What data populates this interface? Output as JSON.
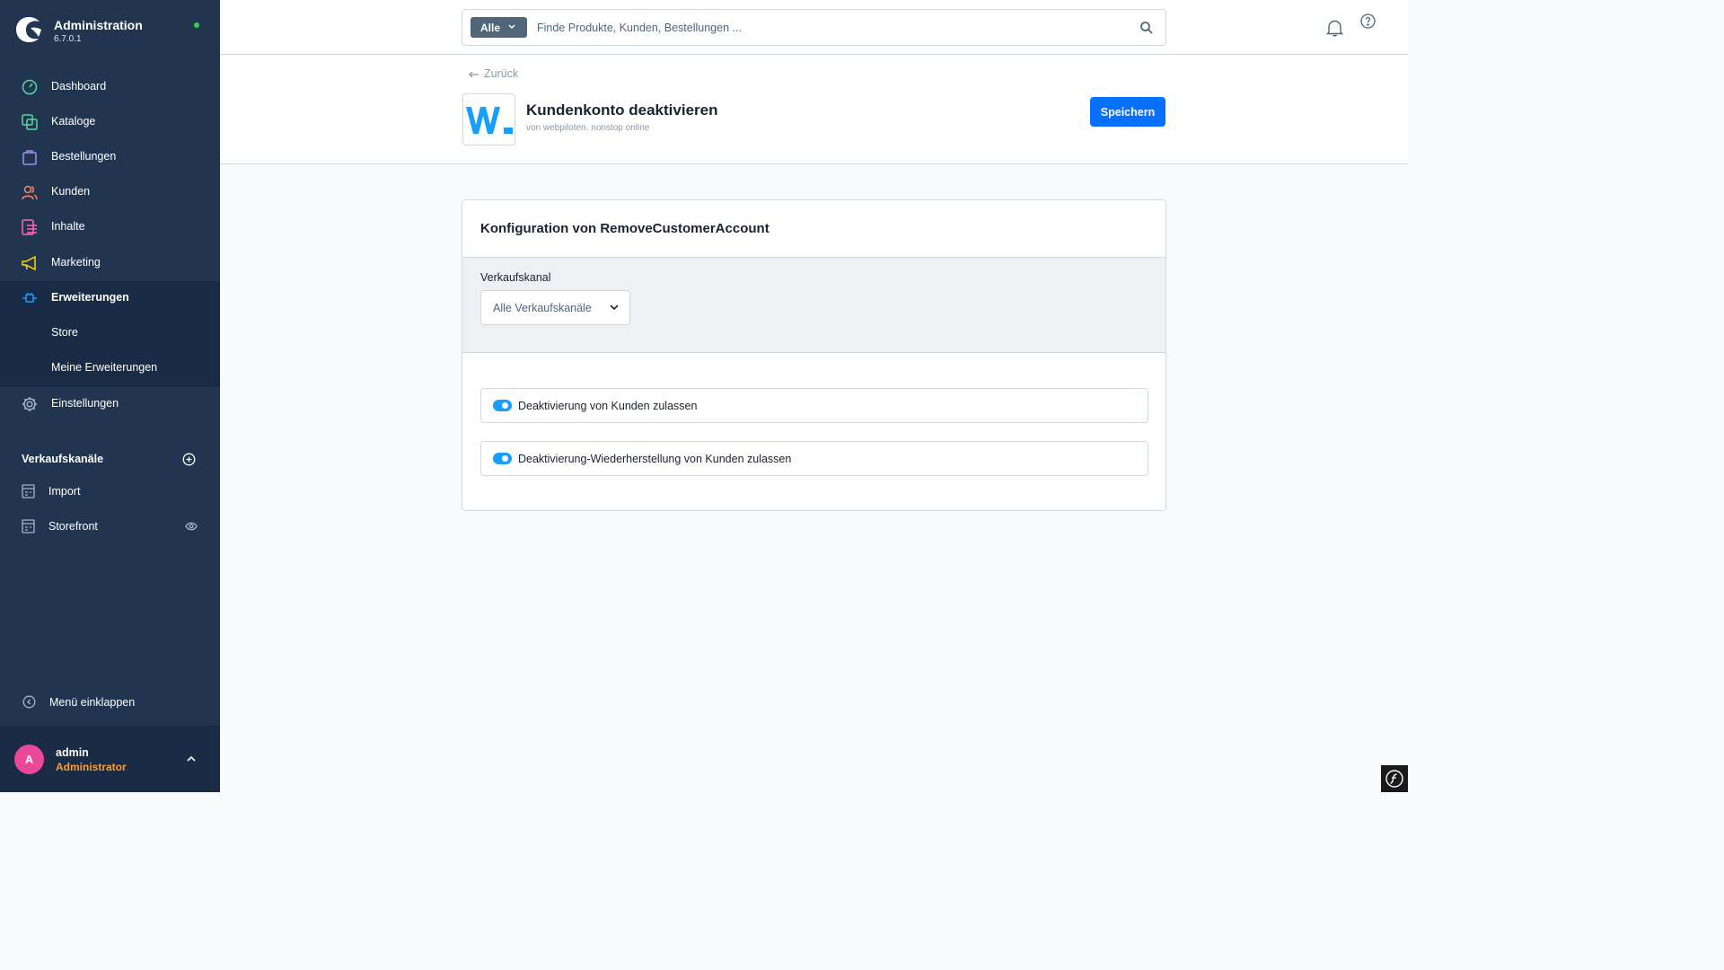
{
  "brand": {
    "title": "Administration",
    "version": "6.7.0.1",
    "status_color": "#37d046"
  },
  "sidebar": {
    "items": [
      {
        "label": "Dashboard",
        "icon": "gauge-icon",
        "color": "#57d9a3"
      },
      {
        "label": "Kataloge",
        "icon": "products-icon",
        "color": "#57d9a3"
      },
      {
        "label": "Bestellungen",
        "icon": "shopping-bag-icon",
        "color": "#a092f0"
      },
      {
        "label": "Kunden",
        "icon": "users-icon",
        "color": "#f88962"
      },
      {
        "label": "Inhalte",
        "icon": "content-icon",
        "color": "#ff68b4"
      },
      {
        "label": "Marketing",
        "icon": "megaphone-icon",
        "color": "#ffd700"
      },
      {
        "label": "Erweiterungen",
        "icon": "plug-icon",
        "color": "#189eff",
        "active": true
      },
      {
        "label": "Einstellungen",
        "icon": "gear-icon",
        "color": "#a8b5c5"
      }
    ],
    "subitems": [
      {
        "label": "Store"
      },
      {
        "label": "Meine Erweiterungen"
      }
    ],
    "sales_channels_title": "Verkaufskanäle",
    "sales_channels": [
      {
        "label": "Import",
        "icon": "storefront-icon"
      },
      {
        "label": "Storefront",
        "icon": "storefront-icon"
      }
    ],
    "collapse_label": "Menü einklappen"
  },
  "user": {
    "initial": "A",
    "name": "admin",
    "role": "Administrator"
  },
  "search": {
    "type_label": "Alle",
    "placeholder": "Finde Produkte, Kunden, Bestellungen ..."
  },
  "page": {
    "back_label": "Zurück",
    "plugin_title": "Kundenkonto deaktivieren",
    "plugin_vendor": "von webpiloten. nonstop online",
    "save_label": "Speichern"
  },
  "config": {
    "title": "Konfiguration von RemoveCustomerAccount",
    "channel_label": "Verkaufskanal",
    "channel_value": "Alle Verkaufskanäle",
    "switches": [
      {
        "label": "Deaktivierung von Kunden zulassen",
        "checked": true
      },
      {
        "label": "Deaktivierung-Wiederherstellung von Kunden zulassen",
        "checked": true
      }
    ]
  }
}
